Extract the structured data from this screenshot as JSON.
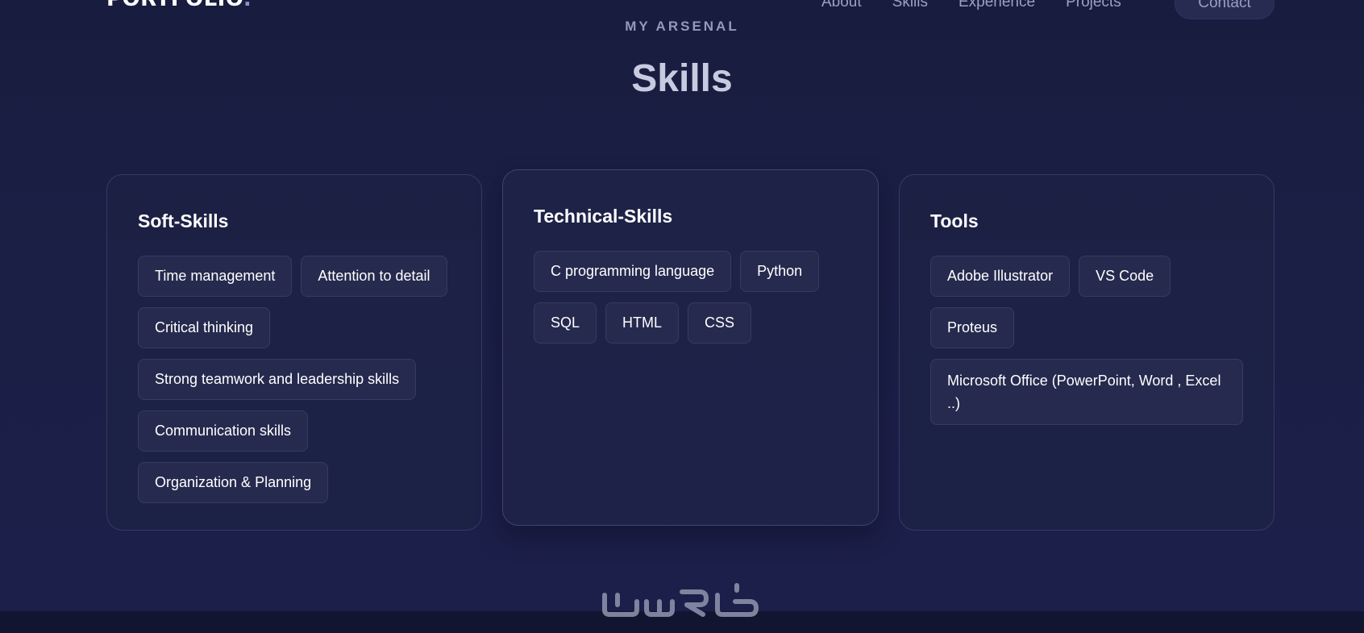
{
  "nav": {
    "brand": "PORTFOLIO",
    "brand_dot": ".",
    "links": [
      "About",
      "Skills",
      "Experience",
      "Projects"
    ],
    "contact": "Contact"
  },
  "section": {
    "eyebrow": "MY ARSENAL",
    "title": "Skills"
  },
  "cards": {
    "soft": {
      "title": "Soft-Skills",
      "chips": [
        "Time management",
        "Attention to detail",
        "Critical thinking",
        "Strong teamwork and leadership skills",
        "Communication skills",
        "Organization & Planning"
      ]
    },
    "tech": {
      "title": "Technical-Skills",
      "chips": [
        "C programming language",
        "Python",
        "SQL",
        "HTML",
        "CSS"
      ]
    },
    "tools": {
      "title": "Tools",
      "chips": [
        "Adobe Illustrator",
        "VS Code",
        "Proteus",
        "Microsoft Office (PowerPoint, Word , Excel ..)"
      ]
    }
  },
  "watermark": {
    "text": "خمسات",
    "icon": "khamsat-logo-icon"
  },
  "colors": {
    "background": "#1b1f45",
    "card_border": "#343a66",
    "chip_bg": "#262a4e",
    "muted_text": "#9aa0c2"
  }
}
